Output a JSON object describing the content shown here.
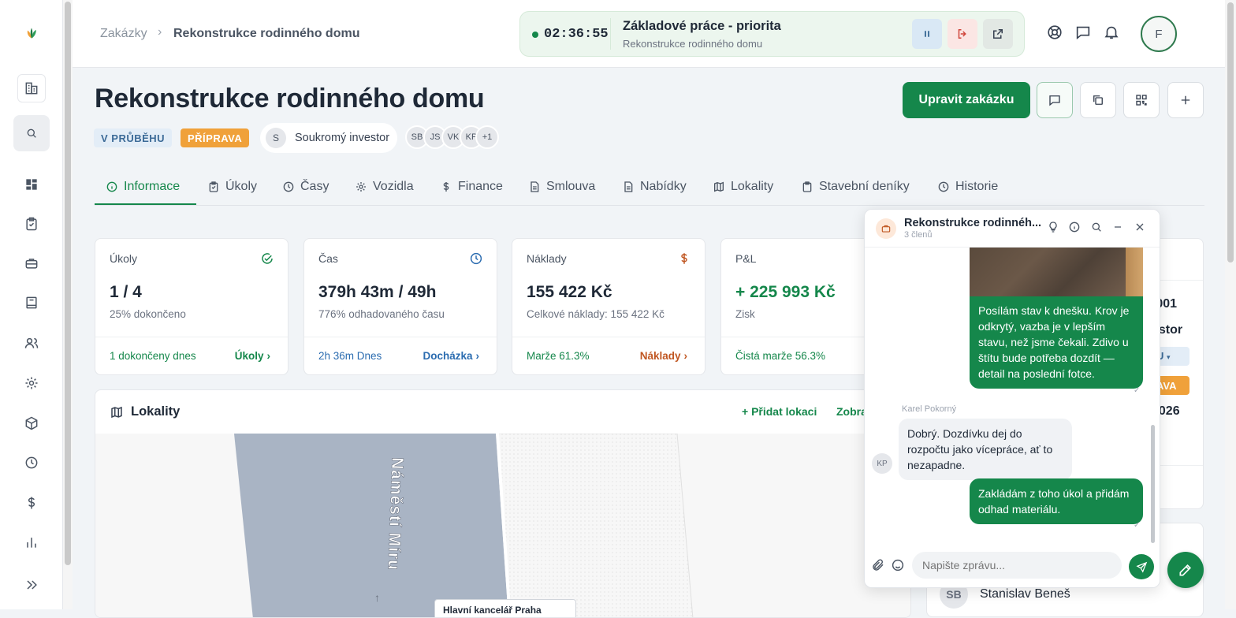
{
  "breadcrumb": {
    "parent": "Zakázky",
    "current": "Rekonstrukce rodinného domu"
  },
  "timer": {
    "time": "02:36:55",
    "task": "Základové práce - priorita",
    "project": "Rekonstrukce rodinného domu"
  },
  "user": {
    "initial": "F"
  },
  "project": {
    "title": "Rekonstrukce rodinného domu",
    "status_badge": "V PRŮBĚHU",
    "phase_badge": "PŘÍPRAVA",
    "client_initial": "S",
    "client": "Soukromý investor",
    "members": [
      "SB",
      "JS",
      "VK",
      "KP"
    ],
    "members_more": "+1"
  },
  "actions": {
    "edit_label": "Upravit zakázku"
  },
  "tabs": [
    "Informace",
    "Úkoly",
    "Časy",
    "Vozidla",
    "Finance",
    "Smlouva",
    "Nabídky",
    "Lokality",
    "Stavební deníky",
    "Historie"
  ],
  "cards": [
    {
      "label": "Úkoly",
      "value": "1 / 4",
      "sub": "25% dokončeno",
      "foot": "1 dokončeny dnes",
      "link": "Úkoly"
    },
    {
      "label": "Čas",
      "value": "379h 43m / 49h",
      "sub": "776% odhadovaného času",
      "foot": "2h 36m Dnes",
      "link": "Docházka"
    },
    {
      "label": "Náklady",
      "value": "155 422 Kč",
      "sub": "Celkové náklady: 155 422 Kč",
      "foot": "Marže 61.3%",
      "link": "Náklady"
    },
    {
      "label": "P&L",
      "value": "+ 225 993 Kč",
      "sub": "Zisk",
      "foot": "Čistá marže 56.3%",
      "link": ""
    }
  ],
  "lokality": {
    "title": "Lokality",
    "add_label": "Přidat lokaci",
    "show_label": "Zobra",
    "street": "Náměstí Míru",
    "office_label": "Hlavní kancelář Praha"
  },
  "right_panel": {
    "code": "-001",
    "investor": "estor",
    "status_short": "U",
    "phase_short": "AVA",
    "year": "2026",
    "person_initials": "SB",
    "person_name": "Stanislav Beneš"
  },
  "chat": {
    "title": "Rekonstrukce rodinnéh...",
    "members": "3 členů",
    "messages": [
      {
        "from": "me",
        "text": "Posílám stav k dnešku. Krov je odkrytý, vazba je v lepším stavu, než jsme čekali. Zdivo u štítu bude potřeba dozdít — detail na poslední fotce."
      },
      {
        "from": "them",
        "author": "Karel Pokorný",
        "initials": "KP",
        "text": "Dobrý. Dozdívku dej do rozpočtu jako vícepráce, ať to nezapadne."
      },
      {
        "from": "me",
        "text": "Zakládám z toho úkol a přidám odhad materiálu."
      }
    ],
    "input_placeholder": "Napište zprávu..."
  },
  "colors": {
    "primary": "#15874b",
    "status_bg": "#e3edf7",
    "status_fg": "#3b6a97",
    "phase_bg": "#f0a13a",
    "cost": "#c05621"
  }
}
